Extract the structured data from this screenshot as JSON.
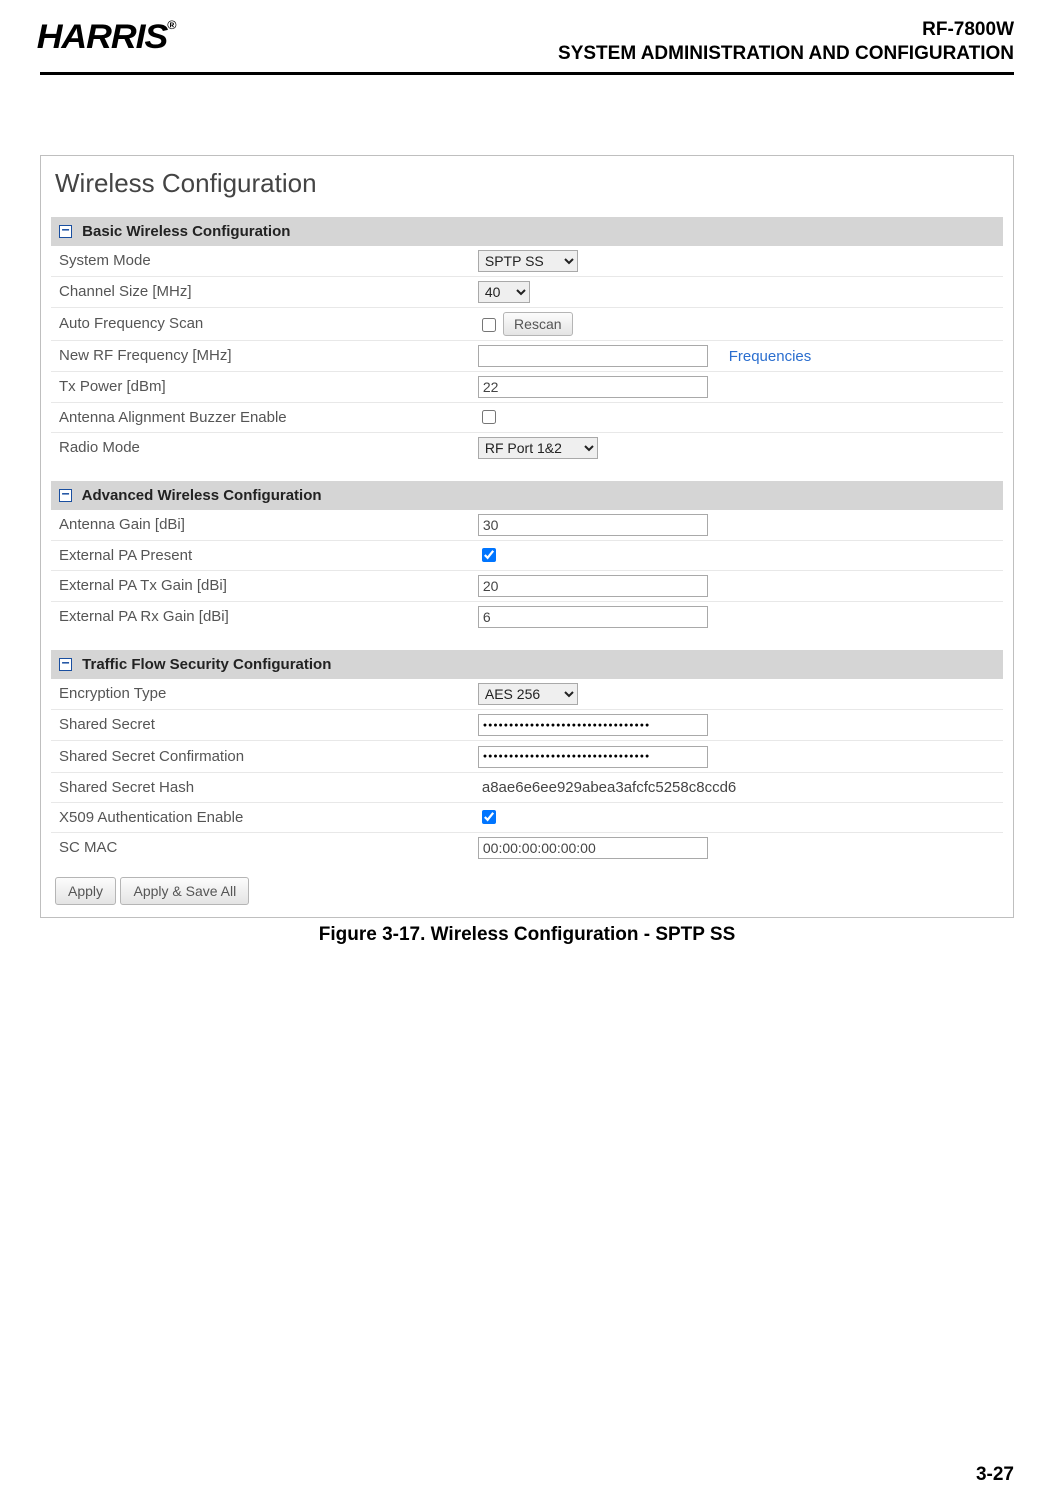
{
  "header": {
    "logo_text": "HARRIS",
    "logo_reg": "®",
    "doc_code": "RF-7800W",
    "doc_section": "SYSTEM ADMINISTRATION AND CONFIGURATION"
  },
  "panel": {
    "title": "Wireless Configuration"
  },
  "sections": {
    "basic": {
      "header": "Basic Wireless Configuration",
      "collapse_glyph": "−",
      "system_mode": {
        "label": "System Mode",
        "value": "SPTP SS"
      },
      "channel_size": {
        "label": "Channel Size [MHz]",
        "value": "40"
      },
      "auto_freq_scan": {
        "label": "Auto Frequency Scan",
        "checked": false,
        "rescan_label": "Rescan"
      },
      "new_rf_freq": {
        "label": "New RF Frequency [MHz]",
        "value": "",
        "link_label": "Frequencies"
      },
      "tx_power": {
        "label": "Tx Power [dBm]",
        "value": "22"
      },
      "ant_buzzer": {
        "label": "Antenna Alignment Buzzer Enable",
        "checked": false
      },
      "radio_mode": {
        "label": "Radio Mode",
        "value": "RF Port 1&2"
      }
    },
    "advanced": {
      "header": "Advanced Wireless Configuration",
      "collapse_glyph": "−",
      "ant_gain": {
        "label": "Antenna Gain [dBi]",
        "value": "30"
      },
      "ext_pa_present": {
        "label": "External PA Present",
        "checked": true
      },
      "ext_pa_tx": {
        "label": "External PA Tx Gain [dBi]",
        "value": "20"
      },
      "ext_pa_rx": {
        "label": "External PA Rx Gain [dBi]",
        "value": "6"
      }
    },
    "tfs": {
      "header": "Traffic Flow Security Configuration",
      "collapse_glyph": "−",
      "enc_type": {
        "label": "Encryption Type",
        "value": "AES 256"
      },
      "shared_secret": {
        "label": "Shared Secret",
        "value": "●●●●●●●●●●●●●●●●●●●●●●●●●●●●●●●●"
      },
      "shared_secret_conf": {
        "label": "Shared Secret Confirmation",
        "value": "●●●●●●●●●●●●●●●●●●●●●●●●●●●●●●●●"
      },
      "shared_secret_hash": {
        "label": "Shared Secret Hash",
        "value": "a8ae6e6ee929abea3afcfc5258c8ccd6"
      },
      "x509": {
        "label": "X509 Authentication Enable",
        "checked": true
      },
      "sc_mac": {
        "label": "SC MAC",
        "value": "00:00:00:00:00:00"
      }
    }
  },
  "buttons": {
    "apply": "Apply",
    "apply_save": "Apply & Save All"
  },
  "figure_caption": "Figure 3-17.  Wireless Configuration - SPTP SS",
  "page_number": "3-27"
}
